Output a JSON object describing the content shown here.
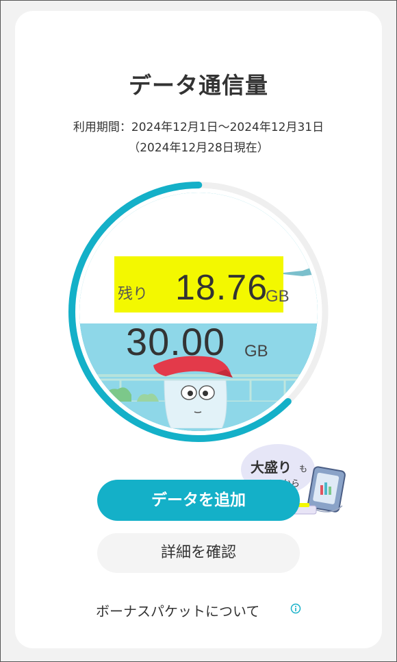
{
  "page": {
    "title": "データ通信量",
    "period_line1": "利用期間：2024年12月1日〜2024年12月31日",
    "period_line2": "（2024年12月28日現在）"
  },
  "gauge": {
    "remaining_label": "残り",
    "remaining_value": "18.76",
    "remaining_unit": "GB",
    "total_value": "30.00",
    "total_unit": "GB",
    "remaining_fraction": 0.625,
    "colors": {
      "accent": "#14b0c8",
      "track": "#efefef",
      "highlight": "#f3f800",
      "sky": "#8ed7e8"
    }
  },
  "promo": {
    "main": "大盛り",
    "suffix": "も",
    "sub": "コチラから"
  },
  "actions": {
    "add_data": "データを追加",
    "details": "詳細を確認",
    "bonus_packet": "ボーナスパケットについて"
  },
  "icons": {
    "info": "info-icon",
    "mascot": "mascot-icon",
    "phone": "phone-icon"
  }
}
